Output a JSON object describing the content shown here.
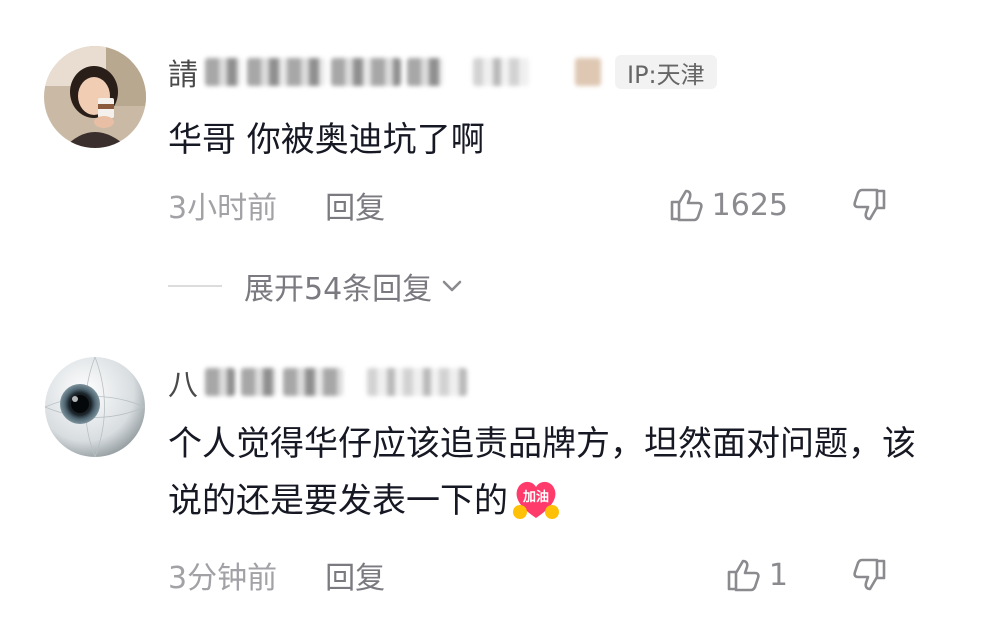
{
  "comments": [
    {
      "username_prefix": "請",
      "ip_label": "IP:天津",
      "text": "华哥 你被奥迪坑了啊",
      "time": "3小时前",
      "reply_label": "回复",
      "like_count": "1625",
      "expand_label": "展开54条回复",
      "avatar": "woman-holding-cup-avatar"
    },
    {
      "username_prefix": "八",
      "text": "个人觉得华仔应该追责品牌方，坦然面对问题，该说的还是要发表一下的",
      "emoji_label": "加油",
      "time": "3分钟前",
      "reply_label": "回复",
      "like_count": "1",
      "avatar": "eyeball-avatar"
    }
  ],
  "icons": {
    "like": "thumbs-up-icon",
    "dislike": "thumbs-down-icon",
    "expand": "chevron-down-icon"
  },
  "colors": {
    "text_primary": "#161823",
    "text_secondary": "#a1a1a6",
    "emoji_red": "#ff3b6b",
    "emoji_yellow": "#ffc107"
  }
}
